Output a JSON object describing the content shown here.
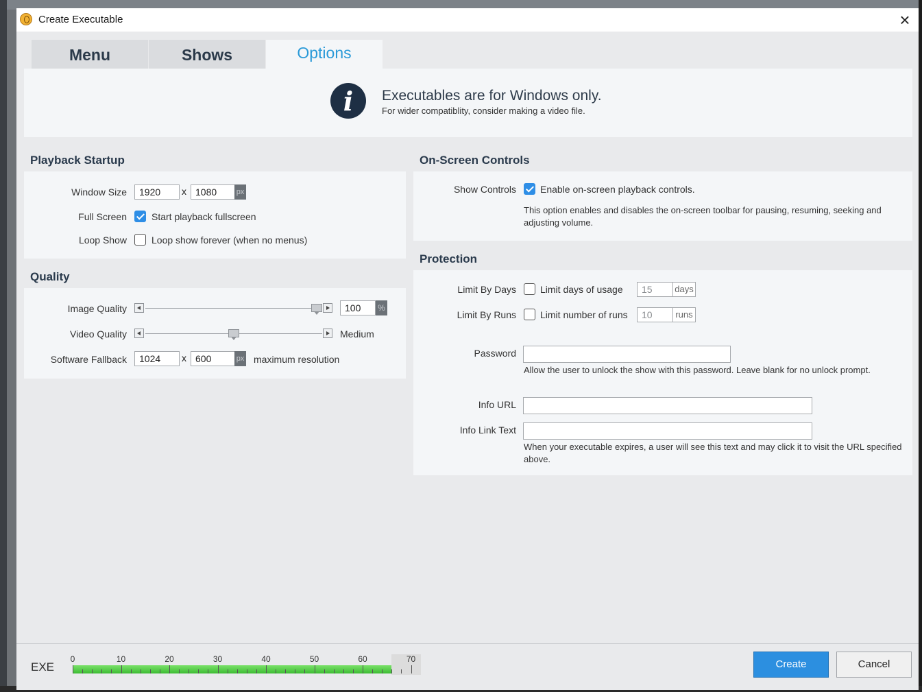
{
  "window": {
    "title": "Create Executable"
  },
  "tabs": [
    {
      "label": "Menu",
      "active": false
    },
    {
      "label": "Shows",
      "active": false
    },
    {
      "label": "Options",
      "active": true
    }
  ],
  "banner": {
    "icon": "info-icon",
    "title": "Executables are for Windows only.",
    "subtitle": "For wider compatiblity, consider making a video file."
  },
  "playback": {
    "title": "Playback Startup",
    "window_size_label": "Window Size",
    "width": "1920",
    "x": "x",
    "height": "1080",
    "unit": "px",
    "fullscreen_label": "Full Screen",
    "fullscreen_text": "Start playback fullscreen",
    "fullscreen_checked": true,
    "loop_label": "Loop Show",
    "loop_text": "Loop show forever (when no menus)",
    "loop_checked": false
  },
  "quality": {
    "title": "Quality",
    "image_label": "Image Quality",
    "image_value": "100",
    "image_unit": "%",
    "image_level": 1.0,
    "video_label": "Video Quality",
    "video_value": "Medium",
    "video_level": 0.5,
    "fallback_label": "Software Fallback",
    "fallback_width": "1024",
    "fallback_x": "x",
    "fallback_height": "600",
    "fallback_unit": "px",
    "fallback_note": "maximum resolution"
  },
  "controls": {
    "title": "On-Screen Controls",
    "show_label": "Show Controls",
    "show_text": "Enable on-screen playback controls.",
    "show_checked": true,
    "description": "This option enables and disables the on-screen toolbar for pausing, resuming, seeking and adjusting volume."
  },
  "protection": {
    "title": "Protection",
    "days_label": "Limit By Days",
    "days_text": "Limit days of usage",
    "days_checked": false,
    "days_value": "15",
    "days_unit": "days",
    "runs_label": "Limit By Runs",
    "runs_text": "Limit number of runs",
    "runs_checked": false,
    "runs_value": "10",
    "runs_unit": "runs",
    "password_label": "Password",
    "password_value": "",
    "password_help": "Allow the user to unlock the show with this password. Leave blank for no unlock prompt.",
    "url_label": "Info URL",
    "url_value": "",
    "link_label": "Info Link Text",
    "link_value": "",
    "link_help": "When your executable expires, a user will see this text and may click it to visit the URL specified above."
  },
  "footer": {
    "exe_label": "EXE",
    "ticks": [
      "0",
      "10",
      "20",
      "30",
      "40",
      "50",
      "60",
      "70"
    ],
    "size_value": 66,
    "size_max": 72,
    "create_label": "Create",
    "cancel_label": "Cancel"
  },
  "colors": {
    "accent": "#2a9ad8",
    "button": "#2c8fe0",
    "progress": "#3cbc33"
  }
}
